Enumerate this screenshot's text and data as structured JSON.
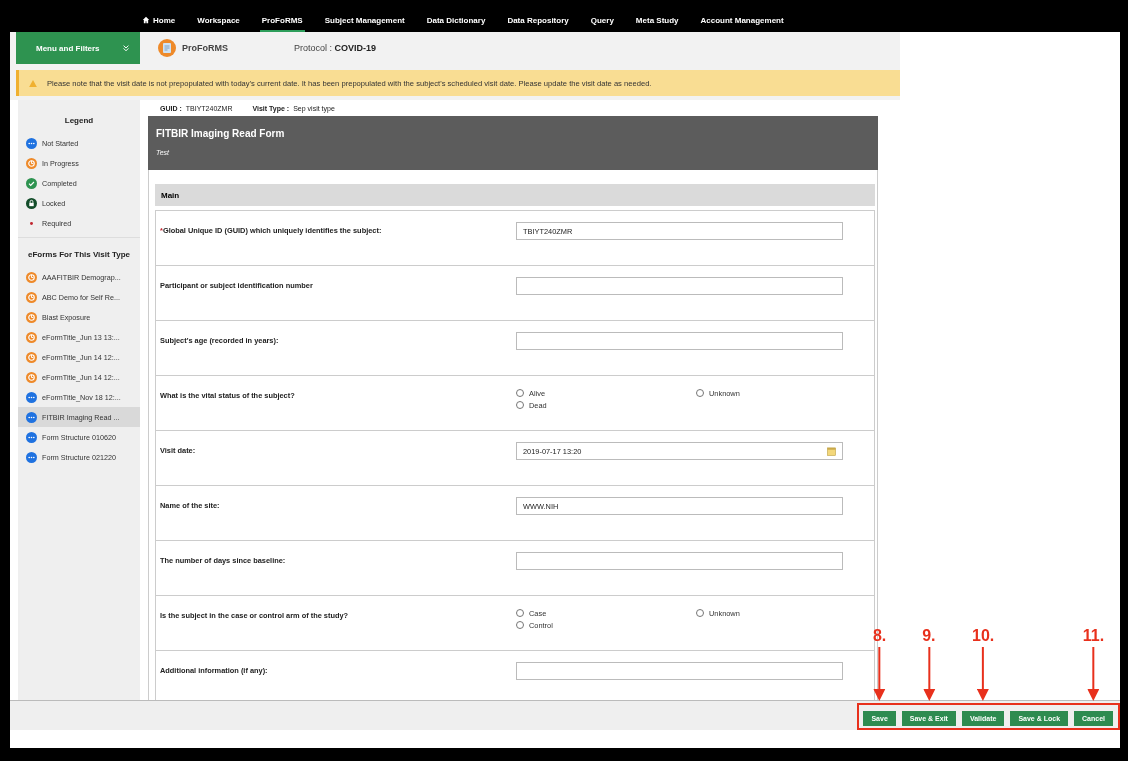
{
  "nav": {
    "items": [
      {
        "label": "Home",
        "kind": "home",
        "selected": false
      },
      {
        "label": "Workspace",
        "selected": false
      },
      {
        "label": "ProFoRMS",
        "selected": true
      },
      {
        "label": "Subject Management",
        "selected": false
      },
      {
        "label": "Data Dictionary",
        "selected": false
      },
      {
        "label": "Data Repository",
        "selected": false
      },
      {
        "label": "Query",
        "selected": false
      },
      {
        "label": "Meta Study",
        "selected": false
      },
      {
        "label": "Account Management",
        "selected": false
      }
    ]
  },
  "header": {
    "menu_button": "Menu and Filters",
    "app_name": "ProFoRMS",
    "protocol_label": "Protocol :",
    "protocol": "COVID-19"
  },
  "banner": "Please note that the visit date is not prepopulated with today's current date. It has been prepopulated with the subject's scheduled visit date. Please update the visit date as needed.",
  "legend": {
    "title": "Legend",
    "items": [
      {
        "label": "Not Started",
        "kind": "not_started"
      },
      {
        "label": "In Progress",
        "kind": "in_progress"
      },
      {
        "label": "Completed",
        "kind": "completed"
      },
      {
        "label": "Locked",
        "kind": "locked"
      },
      {
        "label": "Required",
        "kind": "required"
      }
    ]
  },
  "eforms": {
    "title": "eForms For This Visit Type",
    "items": [
      {
        "label": "AAAFITBIR Demograp...",
        "kind": "in_progress",
        "selected": false
      },
      {
        "label": "ABC Demo for Self Re...",
        "kind": "in_progress",
        "selected": false
      },
      {
        "label": "Blast Exposure",
        "kind": "in_progress",
        "selected": false
      },
      {
        "label": "eFormTitle_Jun 13 13:...",
        "kind": "in_progress",
        "selected": false
      },
      {
        "label": "eFormTitle_Jun 14 12:...",
        "kind": "in_progress",
        "selected": false
      },
      {
        "label": "eFormTitle_Jun 14 12:...",
        "kind": "in_progress",
        "selected": false
      },
      {
        "label": "eFormTitle_Nov 18 12:...",
        "kind": "not_started",
        "selected": false
      },
      {
        "label": "FITBIR Imaging Read ...",
        "kind": "not_started",
        "selected": true
      },
      {
        "label": "Form Structure 010620",
        "kind": "not_started",
        "selected": false
      },
      {
        "label": "Form Structure 021220",
        "kind": "not_started",
        "selected": false
      }
    ]
  },
  "subject": {
    "guid_label": "GUID :",
    "guid": "TBIYT240ZMR",
    "visit_type_label": "Visit Type :",
    "visit_type": "Sep visit type"
  },
  "form": {
    "title": "FITBIR Imaging Read Form",
    "subtitle": "Test",
    "section": "Main",
    "questions": [
      {
        "label": "Global Unique ID (GUID) which uniquely identifies the subject:",
        "kind": "text",
        "marker": "*",
        "value": "TBIYT240ZMR"
      },
      {
        "label": "Participant or subject identification number",
        "kind": "text"
      },
      {
        "label": "Subject's age (recorded in years):",
        "kind": "text"
      },
      {
        "label": "What is the vital status of the subject?",
        "kind": "radio",
        "options": [
          {
            "label": "Alive",
            "selected": false
          },
          {
            "label": "Dead",
            "selected": false
          },
          {
            "label": "Unknown",
            "selected": false
          }
        ]
      },
      {
        "label": "Visit date:",
        "kind": "date",
        "value": "2019-07-17 13:20"
      },
      {
        "label": "Name of the site:",
        "kind": "text",
        "value": "WWW.NIH"
      },
      {
        "label": "The number of days since baseline:",
        "kind": "text"
      },
      {
        "label": "Is the subject in the case or control arm of the study?",
        "kind": "radio",
        "options": [
          {
            "label": "Case",
            "selected": false
          },
          {
            "label": "Control",
            "selected": false
          },
          {
            "label": "Unknown",
            "selected": false
          }
        ]
      },
      {
        "label": "Additional information (if any):",
        "kind": "text"
      }
    ]
  },
  "footer": {
    "highlighted": true,
    "buttons": [
      {
        "label": "Save",
        "annotation": "8."
      },
      {
        "label": "Save & Exit",
        "annotation": "9."
      },
      {
        "label": "Validate",
        "annotation": "10."
      },
      {
        "label": "Save & Lock"
      },
      {
        "label": "Cancel",
        "annotation": "11."
      }
    ]
  }
}
